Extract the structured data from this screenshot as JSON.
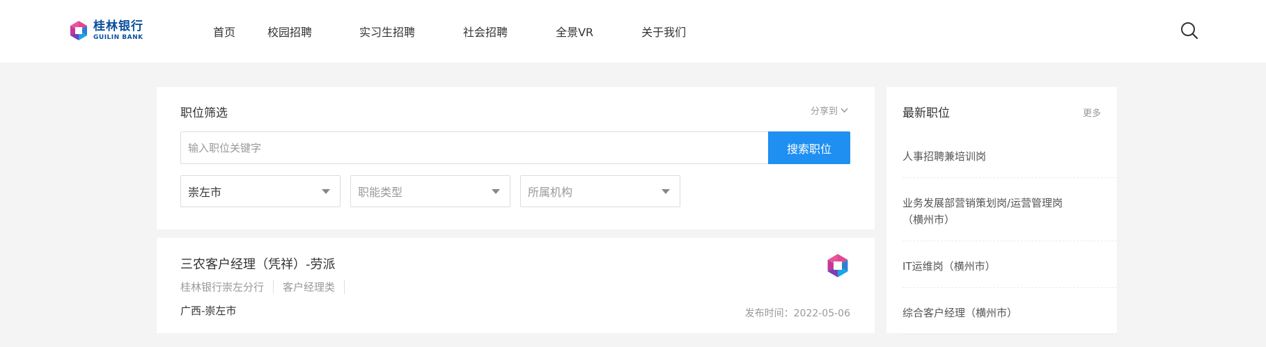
{
  "brand": {
    "name_cn": "桂林银行",
    "name_en": "GUILIN BANK"
  },
  "nav": {
    "items": [
      "首页",
      "校园招聘",
      "实习生招聘",
      "社会招聘",
      "全景VR",
      "关于我们"
    ]
  },
  "filter": {
    "title": "职位筛选",
    "share_label": "分享到",
    "search_placeholder": "输入职位关键字",
    "search_button": "搜索职位",
    "city_value": "崇左市",
    "category_placeholder": "职能类型",
    "org_placeholder": "所属机构"
  },
  "job": {
    "title": "三农客户经理（凭祥）-劳派",
    "org": "桂林银行崇左分行",
    "category": "客户经理类",
    "location": "广西-崇左市",
    "date_label": "发布时间：",
    "date": "2022-05-06"
  },
  "sidebar": {
    "title": "最新职位",
    "more": "更多",
    "items": [
      "人事招聘兼培训岗",
      "业务发展部营销策划岗/运营管理岗（横州市）",
      "IT运维岗（横州市）",
      "综合客户经理（横州市）"
    ]
  },
  "colors": {
    "accent": "#1f8ff2",
    "brand": "#0a4f9c",
    "background": "#f4f4f5"
  }
}
